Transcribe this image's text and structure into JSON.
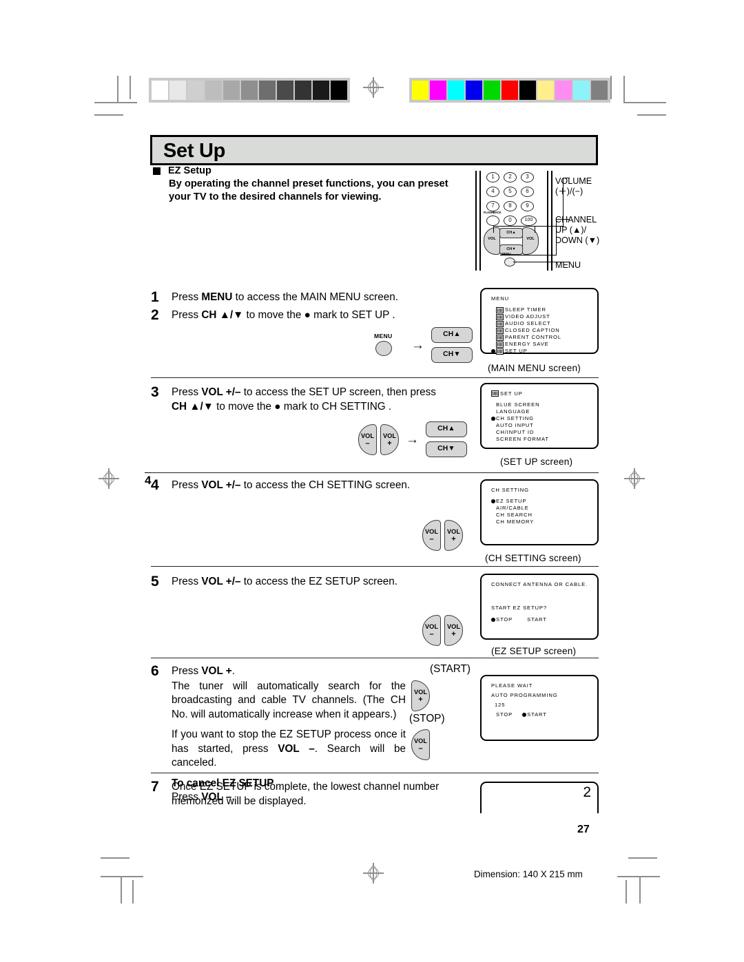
{
  "document": {
    "title": "Set Up",
    "page_number": "27",
    "dimension_note": "Dimension: 140  X 215 mm",
    "side_mark": "4",
    "last_panel_number": "2"
  },
  "section": {
    "bullet_label": "EZ Setup",
    "intro": "By operating the channel preset functions, you can preset your TV to the desired channels for viewing."
  },
  "remote": {
    "keys": [
      [
        "1",
        "2",
        "3"
      ],
      [
        "4",
        "5",
        "6"
      ],
      [
        "7",
        "8",
        "9"
      ],
      [
        "",
        "0",
        "100"
      ]
    ],
    "flashback_label": "FLASHBACK",
    "vol_minus": "VOL",
    "vol_minus_sign": "–",
    "vol_plus": "VOL",
    "vol_plus_sign": "+",
    "ch_up": "CH▲",
    "ch_down": "CH▼",
    "menu_label": "MENU",
    "callouts": [
      {
        "line1": "VOLUME",
        "line2": "(＋)/(−)"
      },
      {
        "line1": "CHANNEL",
        "line2": "UP (▲)/",
        "line3": "DOWN (▼)"
      },
      {
        "line1": "MENU",
        "line2": "",
        "line3": ""
      }
    ]
  },
  "steps": [
    {
      "num": "1",
      "lines": [
        [
          {
            "t": "Press ",
            "b": false
          },
          {
            "t": "MENU",
            "b": true
          },
          {
            "t": " to access the MAIN MENU screen.",
            "b": false
          }
        ]
      ]
    },
    {
      "num": "2",
      "lines": [
        [
          {
            "t": "Press ",
            "b": false
          },
          {
            "t": "CH ▲/▼",
            "b": true
          },
          {
            "t": " to move the  ●  mark to  SET UP .",
            "b": false
          }
        ]
      ]
    },
    {
      "num": "3",
      "lines": [
        [
          {
            "t": "Press ",
            "b": false
          },
          {
            "t": "VOL +/–",
            "b": true
          },
          {
            "t": " to access the SET UP screen, then press",
            "b": false
          }
        ],
        [
          {
            "t": "CH ▲/▼",
            "b": true
          },
          {
            "t": " to move the  ●  mark to  CH SETTING .",
            "b": false
          }
        ]
      ]
    },
    {
      "num": "4",
      "lines": [
        [
          {
            "t": "Press ",
            "b": false
          },
          {
            "t": "VOL +/–",
            "b": true
          },
          {
            "t": " to access the CH SETTING screen.",
            "b": false
          }
        ]
      ]
    },
    {
      "num": "5",
      "lines": [
        [
          {
            "t": "Press ",
            "b": false
          },
          {
            "t": "VOL +/–",
            "b": true
          },
          {
            "t": " to access the EZ SETUP screen.",
            "b": false
          }
        ]
      ]
    },
    {
      "num": "6",
      "lines": [
        [
          {
            "t": "Press ",
            "b": false
          },
          {
            "t": "VOL +",
            "b": true
          },
          {
            "t": ".",
            "b": false
          }
        ]
      ],
      "para1": "The tuner will automatically search for the broadcasting and cable TV channels. (The CH No. will automatically increase when it appears.)",
      "para2_pre": "If you want to stop the EZ SETUP process once it has started, press ",
      "para2_bold": "VOL –",
      "para2_post": ". Search will be canceled.",
      "cancel_heading": "To cancel EZ SETUP",
      "cancel_pre": "Press ",
      "cancel_bold": "VOL –",
      "cancel_post": ".",
      "start_label": "(START)",
      "stop_label": "(STOP)"
    },
    {
      "num": "7",
      "lines": [
        [
          {
            "t": "Once EZ SETUP is complete, the lowest channel number",
            "b": false
          }
        ],
        [
          {
            "t": "memorized will be displayed.",
            "b": false
          }
        ]
      ]
    }
  ],
  "osd_screens": [
    {
      "id": "main-menu",
      "header": "MENU",
      "header_icon": false,
      "items": [
        {
          "label": "SLEEP TIMER",
          "icon": true,
          "selected": false
        },
        {
          "label": "VIDEO ADJUST",
          "icon": true,
          "selected": false
        },
        {
          "label": "AUDIO SELECT",
          "icon": true,
          "selected": false
        },
        {
          "label": "CLOSED CAPTION",
          "icon": true,
          "selected": false
        },
        {
          "label": "PARENT CONTROL",
          "icon": true,
          "selected": false
        },
        {
          "label": "ENERGY SAVE",
          "icon": true,
          "selected": false
        },
        {
          "label": "SET UP",
          "icon": true,
          "selected": true
        }
      ],
      "caption": "(MAIN MENU screen)"
    },
    {
      "id": "set-up",
      "header": "SET UP",
      "header_icon": true,
      "items": [
        {
          "label": "BLUE SCREEN",
          "icon": false,
          "selected": false
        },
        {
          "label": "LANGUAGE",
          "icon": false,
          "selected": false
        },
        {
          "label": "CH SETTING",
          "icon": false,
          "selected": true
        },
        {
          "label": "AUTO INPUT",
          "icon": false,
          "selected": false
        },
        {
          "label": "CH/INPUT ID",
          "icon": false,
          "selected": false
        },
        {
          "label": "SCREEN FORMAT",
          "icon": false,
          "selected": false
        }
      ],
      "caption": "(SET UP screen)"
    },
    {
      "id": "ch-setting",
      "header": "CH SETTING",
      "header_icon": false,
      "items": [
        {
          "label": "EZ SETUP",
          "icon": false,
          "selected": true
        },
        {
          "label": "AIR/CABLE",
          "icon": false,
          "selected": false
        },
        {
          "label": "CH SEARCH",
          "icon": false,
          "selected": false
        },
        {
          "label": "CH MEMORY",
          "icon": false,
          "selected": false
        }
      ],
      "caption": "(CH SETTING screen)"
    },
    {
      "id": "ez-setup",
      "header": "",
      "header_icon": false,
      "text_lines": [
        "CONNECT ANTENNA OR CABLE.",
        "",
        "START EZ SETUP?"
      ],
      "options": [
        {
          "label": "STOP",
          "selected": true
        },
        {
          "label": "START",
          "selected": false
        }
      ],
      "caption": "(EZ SETUP screen)"
    },
    {
      "id": "auto-programming",
      "header": "",
      "header_icon": false,
      "text_lines": [
        "PLEASE WAIT",
        "AUTO PROGRAMMING",
        "125"
      ],
      "options": [
        {
          "label": "STOP",
          "selected": false
        },
        {
          "label": "START",
          "selected": true
        }
      ],
      "caption": ""
    }
  ],
  "calibration": {
    "grayscale": [
      "#ffffff",
      "#e8e8e8",
      "#cfcfcf",
      "#bdbdbd",
      "#a8a8a8",
      "#8f8f8f",
      "#6e6e6e",
      "#4a4a4a",
      "#333333",
      "#1a1a1a",
      "#000000"
    ],
    "colors": [
      "#ffff00",
      "#ff00ff",
      "#00ffff",
      "#0000ee",
      "#00d900",
      "#ff0000",
      "#000000",
      "#ffef8c",
      "#ff8cf0",
      "#8cf4f8",
      "#808080"
    ]
  }
}
